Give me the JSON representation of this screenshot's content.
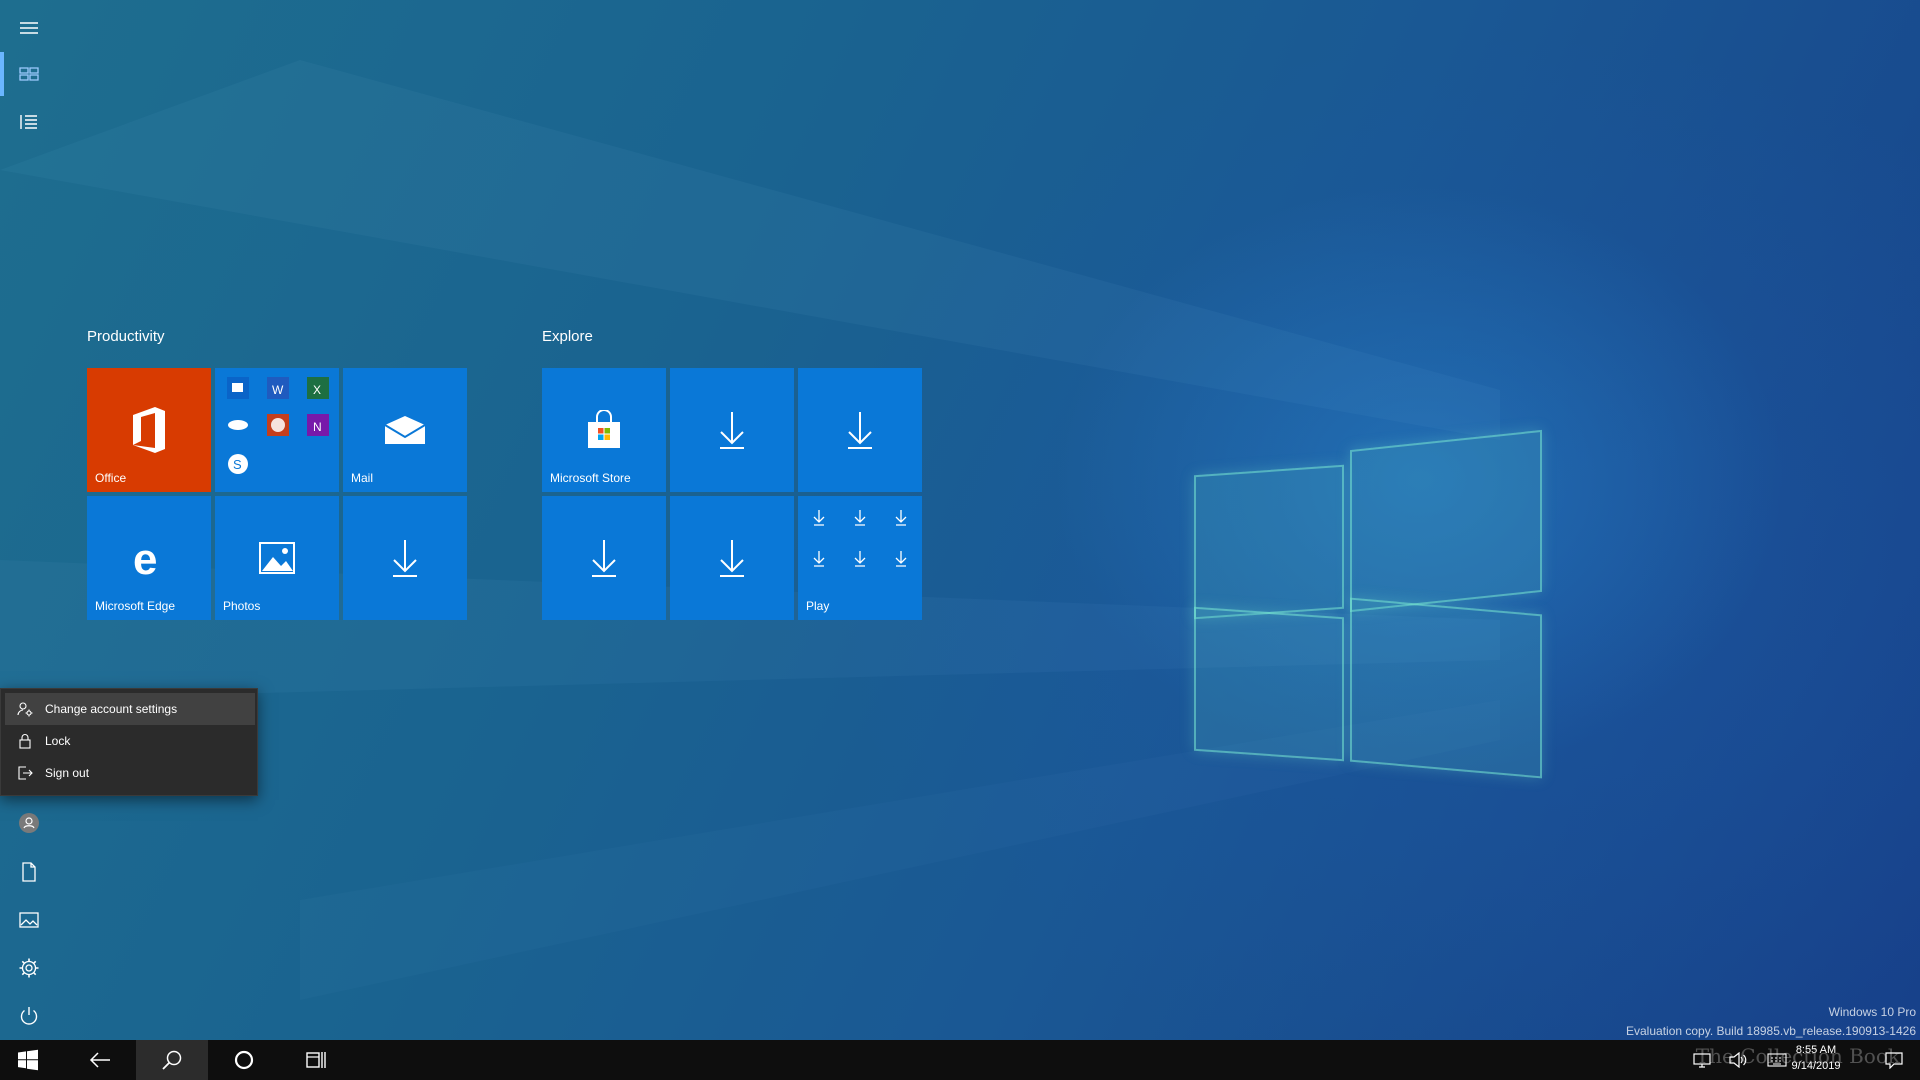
{
  "desktop": {
    "watermark_line1": "Windows 10 Pro",
    "watermark_line2": "Evaluation copy. Build 18985.vb_release.190913-1426",
    "brand_watermark": "The Collection Book"
  },
  "start": {
    "rail": {
      "items": [
        {
          "name": "expand",
          "icon": "hamburger-icon"
        },
        {
          "name": "pinned-tiles",
          "icon": "tiles-icon"
        },
        {
          "name": "all-apps",
          "icon": "list-icon"
        },
        {
          "name": "account",
          "icon": "user-icon"
        },
        {
          "name": "documents",
          "icon": "document-icon"
        },
        {
          "name": "pictures",
          "icon": "pictures-icon"
        },
        {
          "name": "settings",
          "icon": "gear-icon"
        },
        {
          "name": "power",
          "icon": "power-icon"
        }
      ]
    },
    "groups": [
      {
        "title": "Productivity",
        "tiles": [
          {
            "label": "Office",
            "icon": "office-icon",
            "color": "#d83b01"
          },
          {
            "label": "",
            "icon": "office-apps-folder-icon",
            "color": "#0a78d7"
          },
          {
            "label": "Mail",
            "icon": "mail-icon",
            "color": "#0a78d7"
          },
          {
            "label": "Microsoft Edge",
            "icon": "edge-icon",
            "color": "#0a78d7"
          },
          {
            "label": "Photos",
            "icon": "photos-icon",
            "color": "#0a78d7"
          },
          {
            "label": "",
            "icon": "download-icon",
            "color": "#0a78d7"
          }
        ]
      },
      {
        "title": "Explore",
        "tiles": [
          {
            "label": "Microsoft Store",
            "icon": "store-icon",
            "color": "#0a78d7"
          },
          {
            "label": "",
            "icon": "download-icon",
            "color": "#0a78d7"
          },
          {
            "label": "",
            "icon": "download-icon",
            "color": "#0a78d7"
          },
          {
            "label": "",
            "icon": "download-icon",
            "color": "#0a78d7"
          },
          {
            "label": "",
            "icon": "download-icon",
            "color": "#0a78d7"
          },
          {
            "label": "Play",
            "icon": "play-folder-icon",
            "color": "#0a78d7"
          }
        ]
      }
    ],
    "account_menu": {
      "items": [
        {
          "label": "Change account settings",
          "icon": "account-settings-icon",
          "highlighted": true
        },
        {
          "label": "Lock",
          "icon": "lock-icon"
        },
        {
          "label": "Sign out",
          "icon": "sign-out-icon"
        }
      ]
    }
  },
  "taskbar": {
    "buttons": [
      "start-icon",
      "back-icon",
      "search-icon",
      "cortana-icon",
      "task-view-icon"
    ],
    "pressed": "search-icon",
    "tray": {
      "clock_time": "8:55 AM",
      "clock_date": "9/14/2019"
    }
  },
  "colors": {
    "tile_blue": "#0a78d7",
    "office_orange": "#d83b01",
    "menu_bg": "#2b2b2b",
    "taskbar_bg": "#0e0e0e"
  }
}
